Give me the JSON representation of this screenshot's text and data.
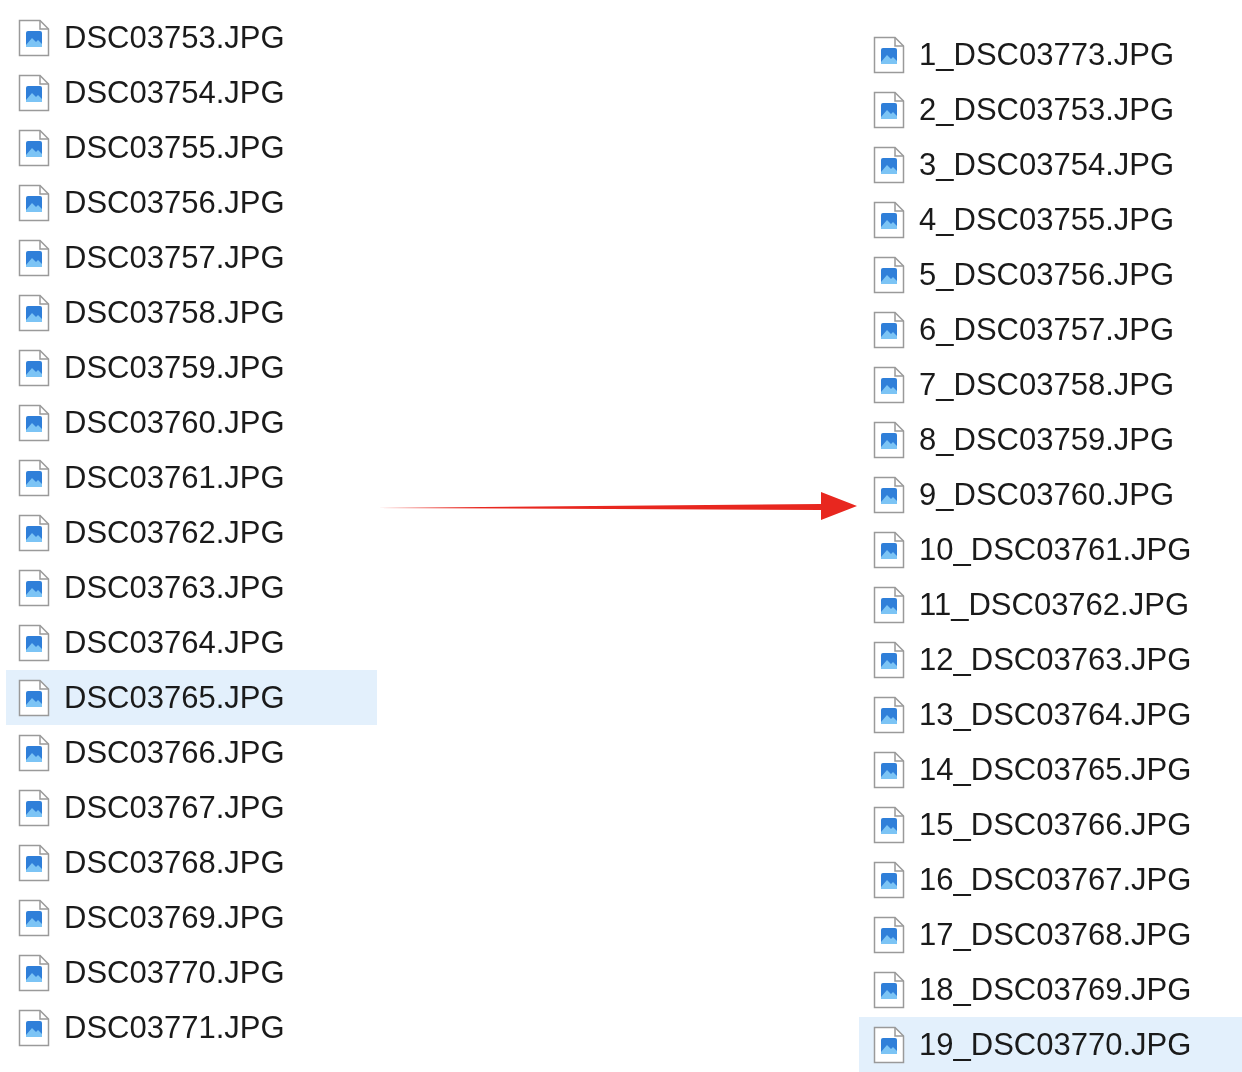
{
  "left_list": {
    "items": [
      {
        "name": "DSC03753.JPG",
        "selected": false
      },
      {
        "name": "DSC03754.JPG",
        "selected": false
      },
      {
        "name": "DSC03755.JPG",
        "selected": false
      },
      {
        "name": "DSC03756.JPG",
        "selected": false
      },
      {
        "name": "DSC03757.JPG",
        "selected": false
      },
      {
        "name": "DSC03758.JPG",
        "selected": false
      },
      {
        "name": "DSC03759.JPG",
        "selected": false
      },
      {
        "name": "DSC03760.JPG",
        "selected": false
      },
      {
        "name": "DSC03761.JPG",
        "selected": false
      },
      {
        "name": "DSC03762.JPG",
        "selected": false
      },
      {
        "name": "DSC03763.JPG",
        "selected": false
      },
      {
        "name": "DSC03764.JPG",
        "selected": false
      },
      {
        "name": "DSC03765.JPG",
        "selected": true
      },
      {
        "name": "DSC03766.JPG",
        "selected": false
      },
      {
        "name": "DSC03767.JPG",
        "selected": false
      },
      {
        "name": "DSC03768.JPG",
        "selected": false
      },
      {
        "name": "DSC03769.JPG",
        "selected": false
      },
      {
        "name": "DSC03770.JPG",
        "selected": false
      },
      {
        "name": "DSC03771.JPG",
        "selected": false
      }
    ]
  },
  "right_list": {
    "items": [
      {
        "name": "1_DSC03773.JPG",
        "selected": false
      },
      {
        "name": "2_DSC03753.JPG",
        "selected": false
      },
      {
        "name": "3_DSC03754.JPG",
        "selected": false
      },
      {
        "name": "4_DSC03755.JPG",
        "selected": false
      },
      {
        "name": "5_DSC03756.JPG",
        "selected": false
      },
      {
        "name": "6_DSC03757.JPG",
        "selected": false
      },
      {
        "name": "7_DSC03758.JPG",
        "selected": false
      },
      {
        "name": "8_DSC03759.JPG",
        "selected": false
      },
      {
        "name": "9_DSC03760.JPG",
        "selected": false
      },
      {
        "name": "10_DSC03761.JPG",
        "selected": false
      },
      {
        "name": "11_DSC03762.JPG",
        "selected": false
      },
      {
        "name": "12_DSC03763.JPG",
        "selected": false
      },
      {
        "name": "13_DSC03764.JPG",
        "selected": false
      },
      {
        "name": "14_DSC03765.JPG",
        "selected": false
      },
      {
        "name": "15_DSC03766.JPG",
        "selected": false
      },
      {
        "name": "16_DSC03767.JPG",
        "selected": false
      },
      {
        "name": "17_DSC03768.JPG",
        "selected": false
      },
      {
        "name": "18_DSC03769.JPG",
        "selected": false
      },
      {
        "name": "19_DSC03770.JPG",
        "selected": true
      }
    ]
  }
}
